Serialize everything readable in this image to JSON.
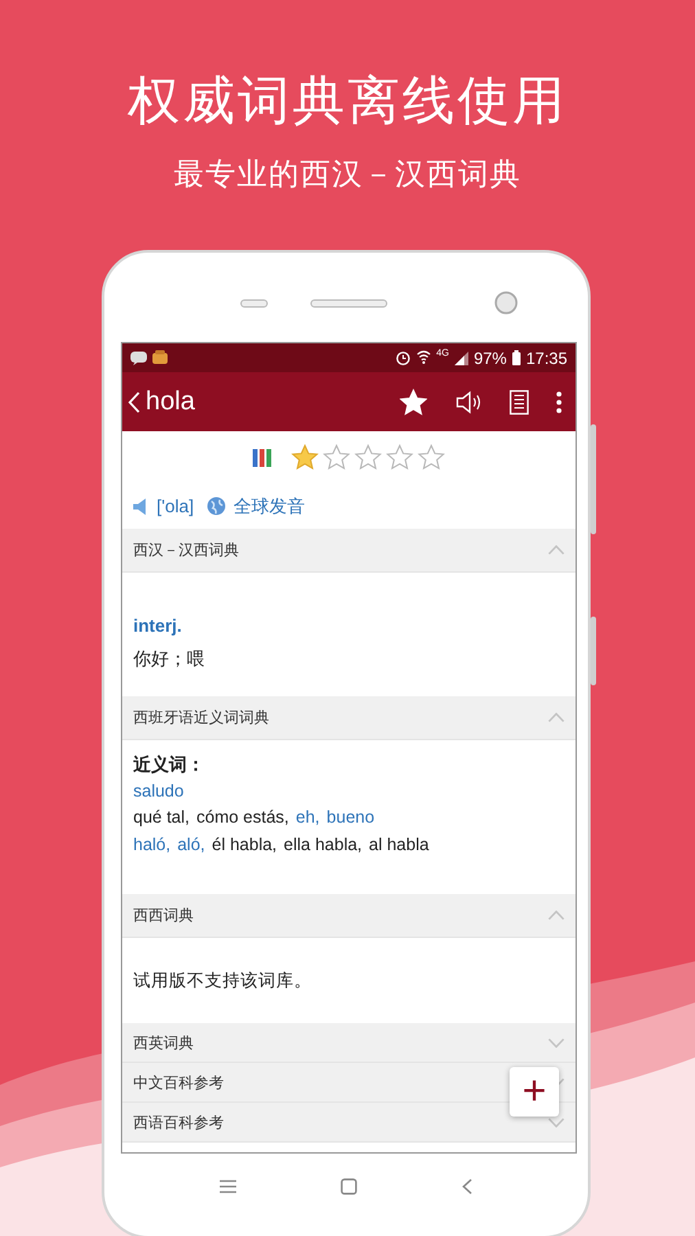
{
  "promo": {
    "title": "权威词典离线使用",
    "subtitle": "最专业的西汉－汉西词典"
  },
  "status_bar": {
    "network": "4G",
    "battery": "97%",
    "time": "17:35"
  },
  "app_bar": {
    "word": "hola",
    "favorited": true
  },
  "rating": {
    "stars": 1
  },
  "pronunciation": {
    "phonetic": "['ola]",
    "global": "全球发音"
  },
  "sections": [
    {
      "title": "西汉－汉西词典",
      "expanded": true,
      "kind": "definition",
      "part_of_speech": "interj.",
      "meaning": "你好；喂"
    },
    {
      "title": "西班牙语近义词词典",
      "expanded": true,
      "kind": "synonyms",
      "heading": "近义词：",
      "lines": [
        [
          {
            "text": "saludo",
            "linked": true
          }
        ],
        [
          {
            "text": "qué tal,",
            "linked": false
          },
          {
            "text": "cómo estás,",
            "linked": false
          },
          {
            "text": "eh,",
            "linked": true
          },
          {
            "text": "bueno",
            "linked": true
          }
        ],
        [
          {
            "text": "haló,",
            "linked": true
          },
          {
            "text": "aló,",
            "linked": true
          },
          {
            "text": "él habla,",
            "linked": false
          },
          {
            "text": "ella habla,",
            "linked": false
          },
          {
            "text": "al habla",
            "linked": false
          }
        ]
      ]
    },
    {
      "title": "西西词典",
      "expanded": true,
      "kind": "notice",
      "message": "试用版不支持该词库。"
    },
    {
      "title": "西英词典",
      "expanded": false
    },
    {
      "title": "中文百科参考",
      "expanded": false
    },
    {
      "title": "西语百科参考",
      "expanded": false
    }
  ],
  "fab": {
    "label": "+"
  }
}
